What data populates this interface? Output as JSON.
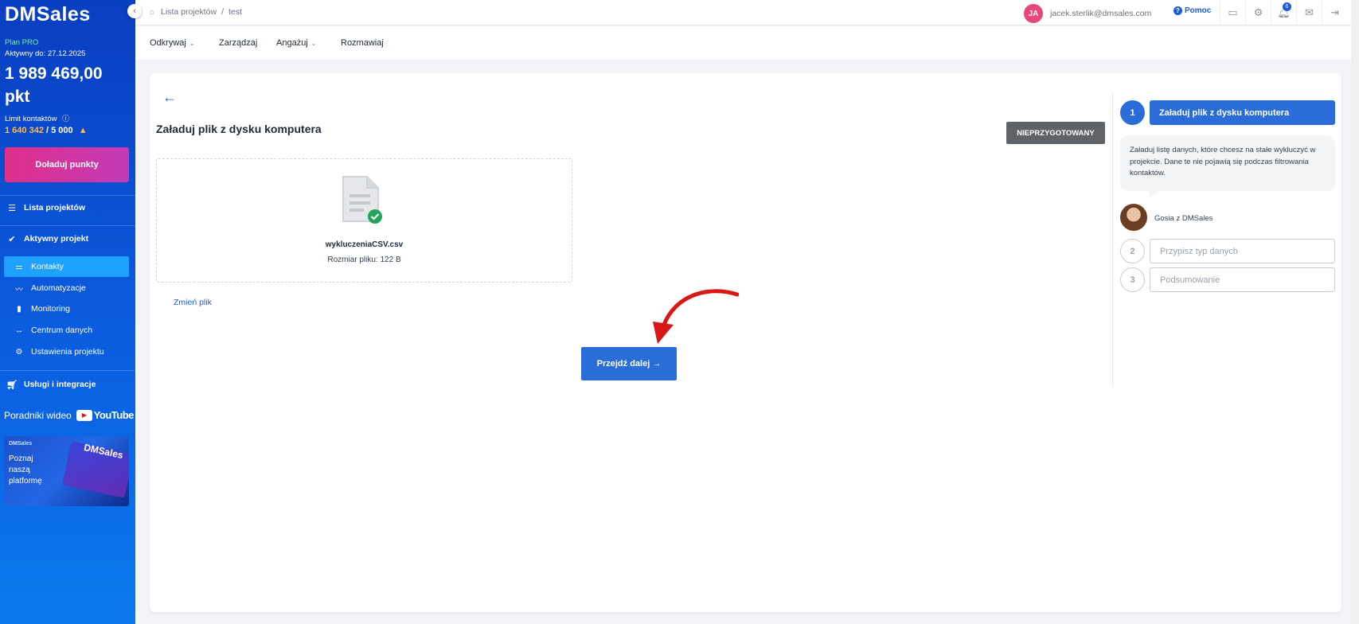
{
  "sidebar": {
    "logo": "DMSales",
    "collapse_icon": "‹",
    "plan": "Plan PRO",
    "active_to": "Aktywny do: 27.12.2025",
    "points": "1 989 469,00 pkt",
    "limit_label": "Limit kontaktów",
    "limit_used": "1 640 342",
    "limit_total": "/ 5 000",
    "topup_label": "Doładuj punkty",
    "nav": [
      {
        "label": "Lista projektów",
        "icon": "list-icon"
      },
      {
        "label": "Aktywny projekt",
        "icon": "check-icon"
      }
    ],
    "sub": [
      {
        "label": "Kontakty",
        "icon": "contacts-icon",
        "active": true
      },
      {
        "label": "Automatyzacje",
        "icon": "automation-icon"
      },
      {
        "label": "Monitoring",
        "icon": "bar-chart-icon"
      },
      {
        "label": "Centrum danych",
        "icon": "arrows-icon"
      },
      {
        "label": "Ustawienia projektu",
        "icon": "gear-icon"
      }
    ],
    "services_label": "Usługi i integracje",
    "video_label": "Poradniki wideo",
    "youtube_label": "YouTube",
    "promo_brand": "DMSales",
    "promo_text": "Poznaj naszą platformę",
    "promo_logo": "DMSales"
  },
  "topbar": {
    "breadcrumb_root": "Lista projektów",
    "breadcrumb_sep": "/",
    "breadcrumb_current": "test",
    "avatar_initials": "JA",
    "email": "jacek.sterlik@dmsales.com",
    "help_label": "Pomoc",
    "bell_count": "6"
  },
  "menu": {
    "discover": "Odkrywaj",
    "manage": "Zarządzaj",
    "engage": "Angażuj",
    "talk": "Rozmawiaj"
  },
  "main": {
    "title": "Załaduj plik z dysku komputera",
    "status": "NIEPRZYGOTOWANY",
    "file_name": "wykluczeniaCSV.csv",
    "file_size": "Rozmiar pliku: 122 B",
    "change_file": "Zmień plik",
    "next_button": "Przejdź dalej →"
  },
  "steps": {
    "items": [
      {
        "number": "1",
        "label": "Załaduj plik z dysku komputera",
        "active": true
      },
      {
        "number": "2",
        "label": "Przypisz typ danych",
        "active": false
      },
      {
        "number": "3",
        "label": "Podsumowanie",
        "active": false
      }
    ],
    "tip": "Załaduj listę danych, które chcesz na stałe wykluczyć w projekcie. Dane te nie pojawią się podczas filtrowania kontaktów.",
    "agent_name": "Gosia z DMSales"
  },
  "colors": {
    "sidebar_top": "#0a3ec0",
    "accent_blue": "#2a6cd8",
    "topup_pink": "#e0308a",
    "status_gray": "#5f6368",
    "annotation_red": "#d81818",
    "success_green": "#22a55a"
  }
}
